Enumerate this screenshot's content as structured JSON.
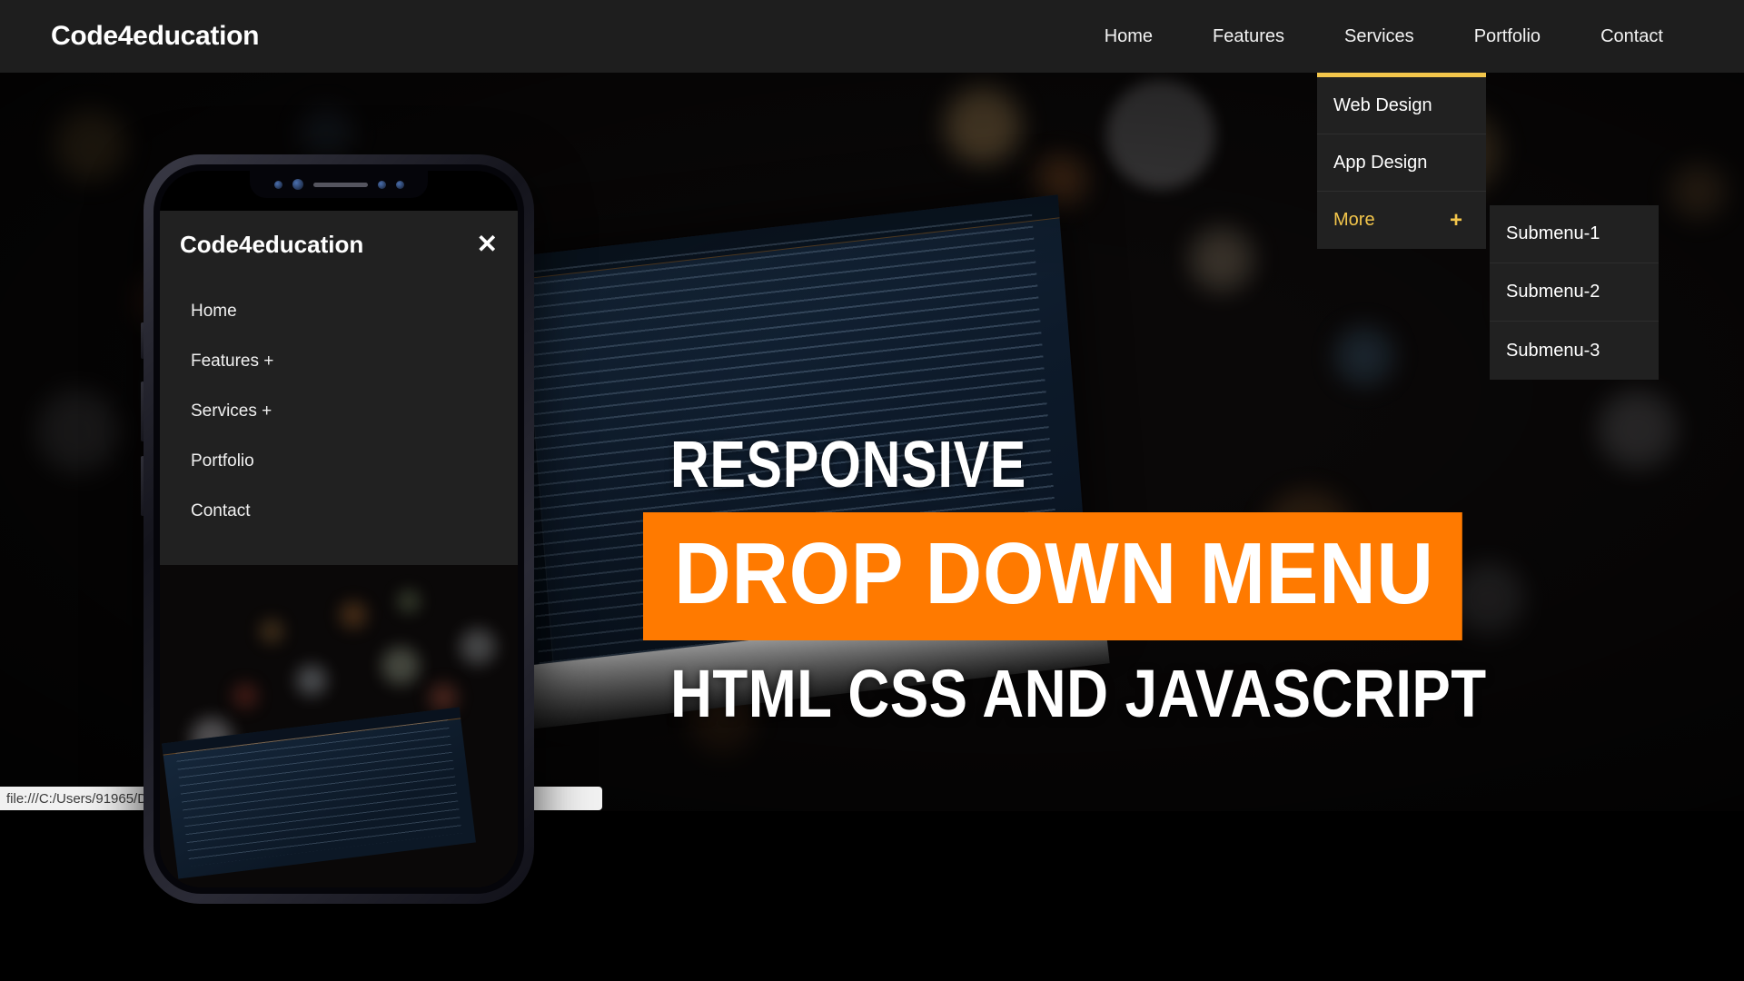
{
  "header": {
    "logo": "Code4education",
    "nav": [
      {
        "label": "Home"
      },
      {
        "label": "Features"
      },
      {
        "label": "Services",
        "active": true
      },
      {
        "label": "Portfolio"
      },
      {
        "label": "Contact"
      }
    ]
  },
  "dropdown": {
    "accent_color": "#f3c64b",
    "background": "#212121",
    "items": [
      {
        "label": "Web Design"
      },
      {
        "label": "App Design"
      },
      {
        "label": "More",
        "indicator": "+",
        "highlighted": true
      }
    ],
    "submenu": [
      {
        "label": "Submenu-1"
      },
      {
        "label": "Submenu-2"
      },
      {
        "label": "Submenu-3"
      }
    ]
  },
  "hero": {
    "line1": "RESPONSIVE",
    "line2": "DROP DOWN MENU",
    "line3": "HTML CSS AND JAVASCRIPT",
    "highlight_color": "#ff7a00"
  },
  "phone": {
    "menu_title": "Code4education",
    "close_icon": "✕",
    "items": [
      {
        "label": "Home"
      },
      {
        "label": "Features +"
      },
      {
        "label": "Services +"
      },
      {
        "label": "Portfolio"
      },
      {
        "label": "Contact"
      }
    ]
  },
  "status_bar": {
    "url": "file:///C:/Users/91965/Downloads/dropdown-menu/index.html#"
  }
}
